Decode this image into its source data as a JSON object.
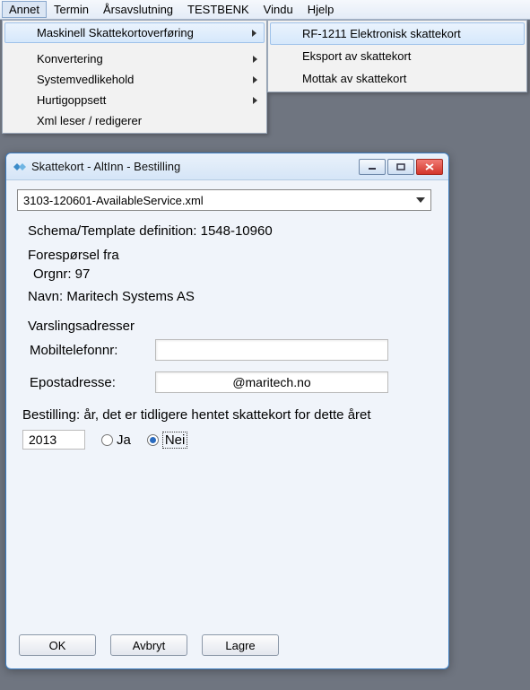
{
  "menubar": {
    "items": [
      "Annet",
      "Termin",
      "Årsavslutning",
      "TESTBENK",
      "Vindu",
      "Hjelp"
    ],
    "open_index": 0
  },
  "dropdown": {
    "items": [
      {
        "label": "Maskinell Skattekortoverføring",
        "has_submenu": true,
        "highlighted": true
      },
      {
        "label": "Konvertering",
        "has_submenu": true
      },
      {
        "label": "Systemvedlikehold",
        "has_submenu": true
      },
      {
        "label": "Hurtigoppsett",
        "has_submenu": true
      },
      {
        "label": "Xml leser / redigerer",
        "has_submenu": false
      }
    ]
  },
  "submenu": {
    "items": [
      {
        "label": "RF-1211 Elektronisk skattekort",
        "highlighted": true
      },
      {
        "label": "Eksport av skattekort"
      },
      {
        "label": "Mottak av skattekort"
      }
    ]
  },
  "dialog": {
    "title": "Skattekort - AltInn - Bestilling",
    "select_value": "3103-120601-AvailableService.xml",
    "schema_line": "Schema/Template definition: 1548-10960",
    "foresporsel_title": "Forespørsel fra",
    "orgnr_label": "Orgnr: 97",
    "navn_label": "Navn: Maritech Systems AS",
    "varsling_title": "Varslingsadresser",
    "mobil_label": "Mobiltelefonnr:",
    "mobil_value": "",
    "epost_label": "Epostadresse:",
    "epost_value": "@maritech.no",
    "bestilling_label": "Bestilling: år, det er tidligere hentet skattekort for dette året",
    "year_value": "2013",
    "radio_ja": "Ja",
    "radio_nei": "Nei",
    "selected_radio": "nei",
    "buttons": {
      "ok": "OK",
      "avbryt": "Avbryt",
      "lagre": "Lagre"
    }
  }
}
